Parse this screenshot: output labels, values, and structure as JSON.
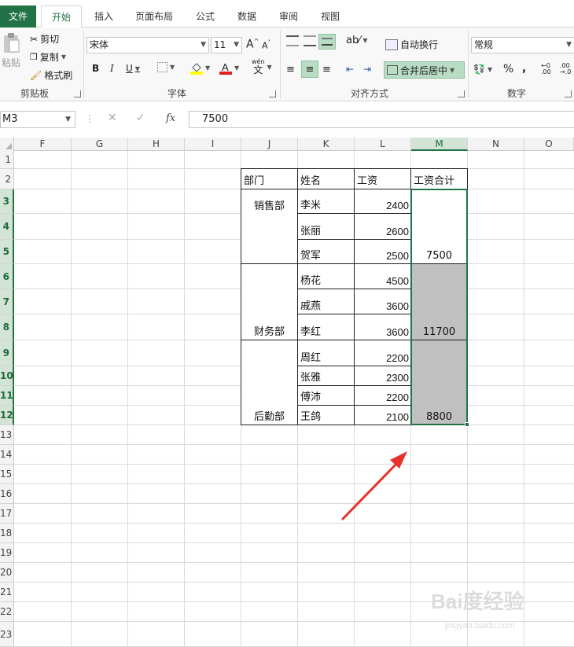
{
  "tabs": [
    "文件",
    "开始",
    "插入",
    "页面布局",
    "公式",
    "数据",
    "审阅",
    "视图"
  ],
  "clipboard": {
    "paste": "粘贴",
    "cut": "剪切",
    "copy": "复制",
    "format_painter": "格式刷",
    "group": "剪贴板"
  },
  "font": {
    "name": "宋体",
    "size": "11",
    "bold": "B",
    "italic": "I",
    "underline": "U",
    "wen": "wén",
    "group": "字体"
  },
  "alignment": {
    "wrap": "自动换行",
    "merge": "合并后居中",
    "group": "对齐方式"
  },
  "number": {
    "format": "常规",
    "percent": "%",
    "comma": ",",
    "group": "数字"
  },
  "formula_bar": {
    "name_box": "M3",
    "fx": "fx",
    "value": "7500"
  },
  "columns": [
    "F",
    "G",
    "H",
    "I",
    "J",
    "K",
    "L",
    "M",
    "N",
    "O"
  ],
  "rows": [
    "1",
    "2",
    "3",
    "4",
    "5",
    "6",
    "7",
    "8",
    "9",
    "10",
    "11",
    "12",
    "13",
    "14",
    "15",
    "16",
    "17",
    "18",
    "19",
    "20",
    "21",
    "22",
    "23"
  ],
  "table": {
    "headers": [
      "部门",
      "姓名",
      "工资",
      "工资合计"
    ],
    "departments": [
      "销售部",
      "财务部",
      "后勤部"
    ],
    "names": [
      "李米",
      "张丽",
      "贺军",
      "杨花",
      "戚燕",
      "李红",
      "周红",
      "张雅",
      "傅沛",
      "王鸽"
    ],
    "salaries": [
      "2400",
      "2600",
      "2500",
      "4500",
      "3600",
      "3600",
      "2200",
      "2300",
      "2200",
      "2100"
    ],
    "totals": [
      "7500",
      "11700",
      "8800"
    ]
  },
  "watermark": {
    "brand": "Bai度经验",
    "url": "jingyan.baidu.com"
  },
  "colors": {
    "excel_green": "#217346",
    "arrow_red": "#e8312a",
    "merged_gray": "#c0c0c0"
  }
}
